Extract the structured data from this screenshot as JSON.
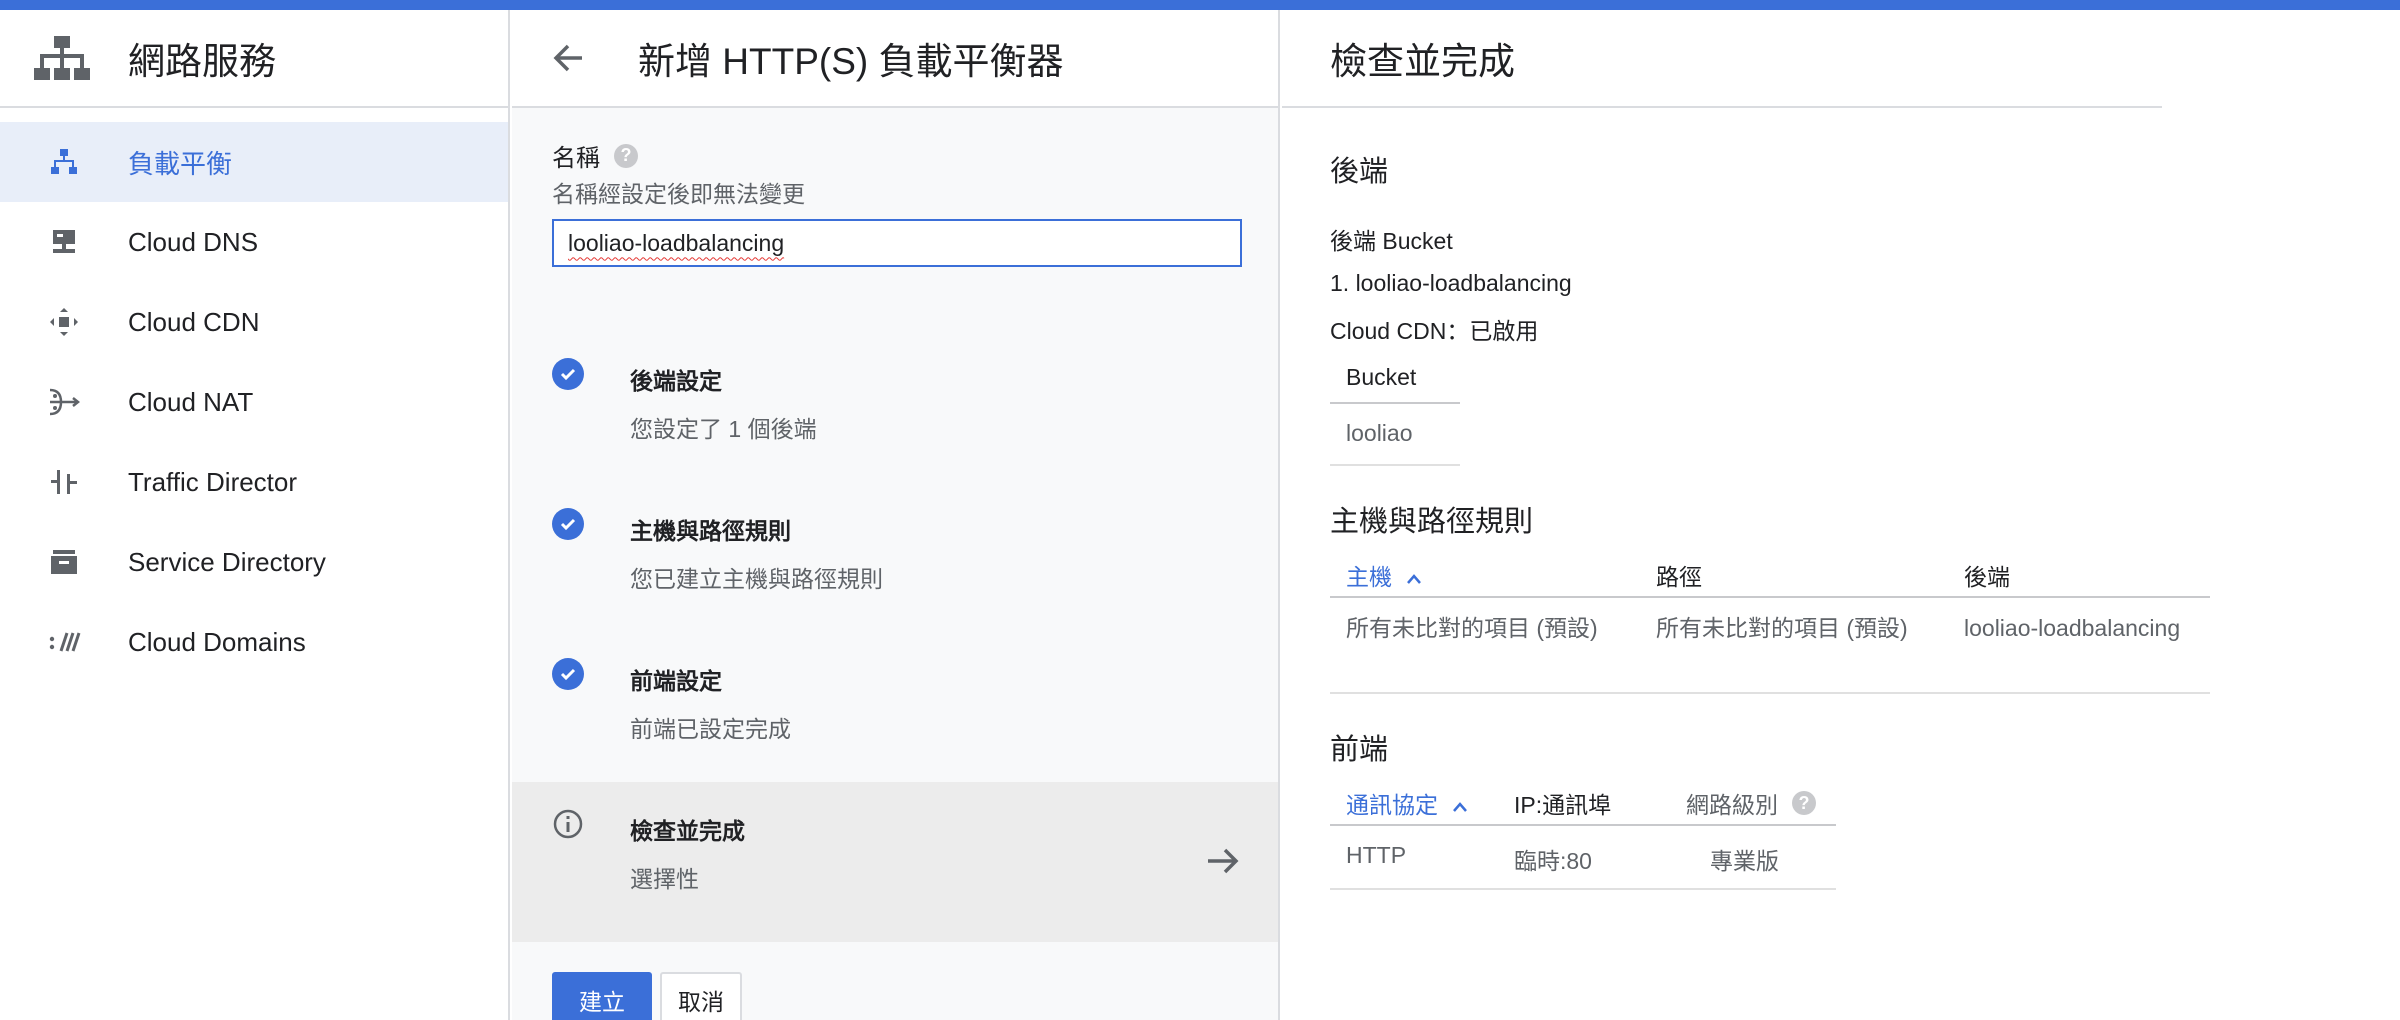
{
  "nav": {
    "title": "網路服務",
    "items": [
      {
        "label": "負載平衡",
        "icon": "load-balancing-icon"
      },
      {
        "label": "Cloud DNS",
        "icon": "dns-icon"
      },
      {
        "label": "Cloud CDN",
        "icon": "cdn-icon"
      },
      {
        "label": "Cloud NAT",
        "icon": "nat-icon"
      },
      {
        "label": "Traffic Director",
        "icon": "traffic-director-icon"
      },
      {
        "label": "Service Directory",
        "icon": "service-directory-icon"
      },
      {
        "label": "Cloud Domains",
        "icon": "domains-icon"
      }
    ]
  },
  "mid": {
    "title": "新增 HTTP(S) 負載平衡器",
    "name_label": "名稱",
    "name_hint": "名稱經設定後即無法變更",
    "name_value": "looliao-loadbalancing",
    "steps": [
      {
        "title": "後端設定",
        "sub": "您設定了 1 個後端"
      },
      {
        "title": "主機與路徑規則",
        "sub": "您已建立主機與路徑規則"
      },
      {
        "title": "前端設定",
        "sub": "前端已設定完成"
      },
      {
        "title": "檢查並完成",
        "sub": "選擇性"
      }
    ],
    "create_label": "建立",
    "cancel_label": "取消"
  },
  "review": {
    "title": "檢查並完成",
    "backend_title": "後端",
    "backend_bucket_label": "後端 Bucket",
    "backend_item": "1. looliao-loadbalancing",
    "cdn_status": "Cloud CDN：已啟用",
    "bucket_header": "Bucket",
    "bucket_value": "looliao",
    "rules_title": "主機與路徑規則",
    "rules_headers": {
      "host": "主機",
      "path": "路徑",
      "backend": "後端"
    },
    "rules_row": {
      "host": "所有未比對的項目 (預設)",
      "path": "所有未比對的項目 (預設)",
      "backend": "looliao-loadbalancing"
    },
    "frontend_title": "前端",
    "frontend_headers": {
      "protocol": "通訊協定",
      "ip_port": "IP:通訊埠",
      "tier": "網路級別"
    },
    "frontend_row": {
      "protocol": "HTTP",
      "ip_port": "臨時:80",
      "tier": "專業版"
    }
  },
  "colors": {
    "accent": "#3b6fd8",
    "active_bg": "#e8eef9"
  }
}
